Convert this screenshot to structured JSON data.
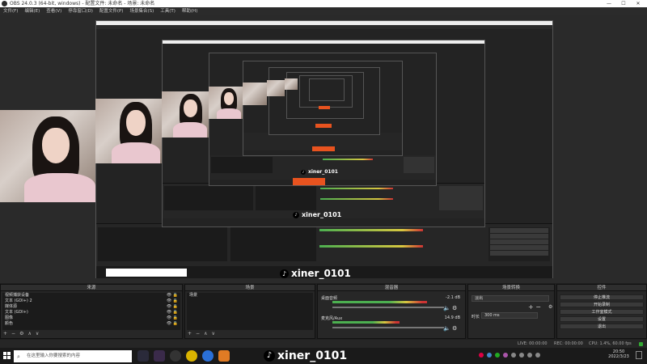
{
  "window": {
    "title": "OBS 24.0.3 (64-bit, windows) - 配置文件: 未命名 - 场景: 未命名",
    "controls": [
      "—",
      "☐",
      "✕"
    ]
  },
  "menubar": {
    "items": [
      "文件(F)",
      "编辑(E)",
      "查看(V)",
      "停靠窗口(D)",
      "配置文件(P)",
      "场景集合(S)",
      "工具(T)",
      "帮助(H)"
    ]
  },
  "overlay": {
    "tiktok_handle": "xiner_0101",
    "tiktok_handle_small": "xiner_0101",
    "tiktok_handle_tiny": "xiner_0101"
  },
  "docks": {
    "sources": {
      "title": "来源",
      "items": [
        "视频捕获设备",
        "文本 (GDI+) 2",
        "媒体源",
        "文本 (GDI+)",
        "图像",
        "颜色"
      ],
      "footer": [
        "+",
        "−",
        "⚙",
        "∧",
        "∨"
      ]
    },
    "scenes": {
      "title": "场景",
      "items": [
        "场景"
      ],
      "footer": [
        "+",
        "−",
        "∧",
        "∨"
      ]
    },
    "mixer": {
      "title": "混音器",
      "channels": [
        {
          "name": "桌面音频",
          "db": "-2.1 dB",
          "level": 0.78
        },
        {
          "name": "麦克风/Aux",
          "db": "14.9 dB",
          "level": 0.55
        }
      ]
    },
    "transitions": {
      "title": "场景转换",
      "type": "淡出",
      "duration_label": "时长",
      "duration": "300 ms"
    },
    "controls": {
      "title": "控件",
      "buttons": [
        "停止推流",
        "开始录制",
        "工作室模式",
        "设置",
        "退出"
      ]
    }
  },
  "status": {
    "live": "LIVE: 00:00:00",
    "rec": "REC: 00:00:00",
    "cpu": "CPU: 1.4%, 60.00 fps"
  },
  "taskbar": {
    "search_placeholder": "在这里输入你要搜索的内容",
    "time": "20:50",
    "date": "2022/3/23"
  },
  "colors": {
    "accent": "#e8531f",
    "panel": "#272727",
    "meter_green": "#4caf50"
  }
}
